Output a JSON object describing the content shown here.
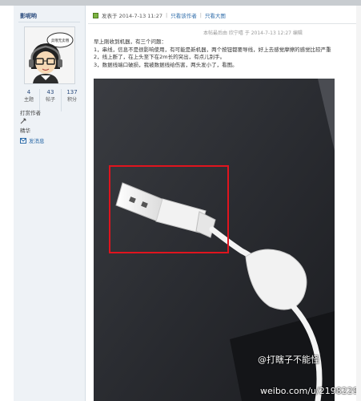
{
  "sidebar": {
    "username": "影呢哟",
    "avatar_text": "卖哦无卖哦",
    "stats": [
      {
        "value": "4",
        "label": "主题"
      },
      {
        "value": "43",
        "label": "帖子"
      },
      {
        "value": "137",
        "label": "积分"
      }
    ],
    "links": [
      {
        "label": "打赏作者"
      },
      {
        "label": "精华"
      },
      {
        "label": "发消息"
      }
    ]
  },
  "header": {
    "breadcrumb": [
      "发表于 2014-7-13 11:27",
      "只看该作者",
      "只看大图"
    ]
  },
  "post": {
    "meta": "本帖最后由 欣宁嘻 于 2014-7-13 12:27 编辑",
    "lines": [
      "早上刚收到机器，有三个问题：",
      "1，串线，信息不是很影响使用，有可能是新机器，两个按钮都要导线，好上去感觉摩擦的感觉比较严重",
      "2，线上断了，在上头至下在2m长的突出，有点儿别手。",
      "3，数据线端口破损，我被数据线给伤害，两头发小了，看图。"
    ]
  },
  "watermark": {
    "handle": "@打瞎子不能怪",
    "url": "weibo.com/u/2198229210"
  },
  "colors": {
    "highlight": "#e0141e",
    "link": "#2b6aa8"
  }
}
